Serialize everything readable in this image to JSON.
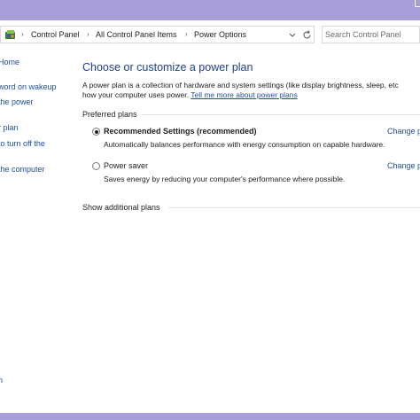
{
  "address_bar": {
    "crumbs": [
      "Control Panel",
      "All Control Panel Items",
      "Power Options"
    ],
    "icon": "control-panel-icon"
  },
  "search": {
    "placeholder": "Search Control Panel"
  },
  "sidebar": {
    "items": [
      {
        "label": "Home"
      },
      {
        "label": "word on wakeup"
      },
      {
        "label": "the power"
      },
      {
        "label": "r plan"
      },
      {
        "label": "to turn off the"
      },
      {
        "label": "the computer"
      },
      {
        "label": "n"
      }
    ]
  },
  "main": {
    "title": "Choose or customize a power plan",
    "description_line1": "A power plan is a collection of hardware and system settings (like display brightness, sleep, etc",
    "description_line2_prefix": "how your computer uses power.",
    "description_link": "Tell me more about power plans",
    "preferred_label": "Preferred plans",
    "plans": [
      {
        "name": "Recommended Settings (recommended)",
        "description": "Automatically balances performance with energy consumption on capable hardware.",
        "change_link": "Change p",
        "selected": true
      },
      {
        "name": "Power saver",
        "description": "Saves energy by reducing your computer's performance where possible.",
        "change_link": "Change p",
        "selected": false
      }
    ],
    "show_additional": "Show additional plans"
  },
  "colors": {
    "titlebar": "#a7a0d8",
    "link": "#1f4e9c",
    "heading": "#1f3f8c"
  }
}
